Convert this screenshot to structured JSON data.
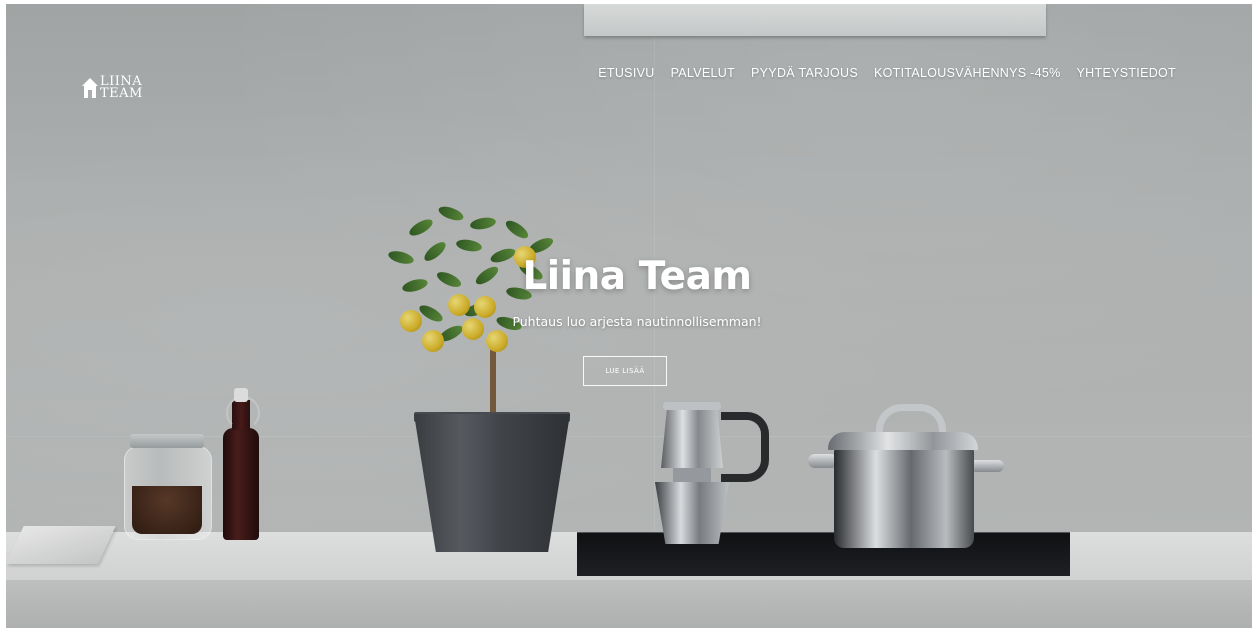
{
  "brand": {
    "logo_line1": "LIINA",
    "logo_line2": "TEAM"
  },
  "nav": {
    "items": [
      {
        "label": "ETUSIVU"
      },
      {
        "label": "PALVELUT"
      },
      {
        "label": "PYYDÄ TARJOUS"
      },
      {
        "label": "KOTITALOUSVÄHENNYS -45%"
      },
      {
        "label": "YHTEYSTIEDOT"
      }
    ]
  },
  "hero": {
    "title": "Liina Team",
    "subtitle": "Puhtaus luo arjesta nautinnollisemman!",
    "button_label": "LUE LISÄÄ"
  },
  "colors": {
    "text": "#ffffff",
    "wall": "#b6b9b9"
  },
  "icons": {
    "logo_icon": "house-icon"
  }
}
